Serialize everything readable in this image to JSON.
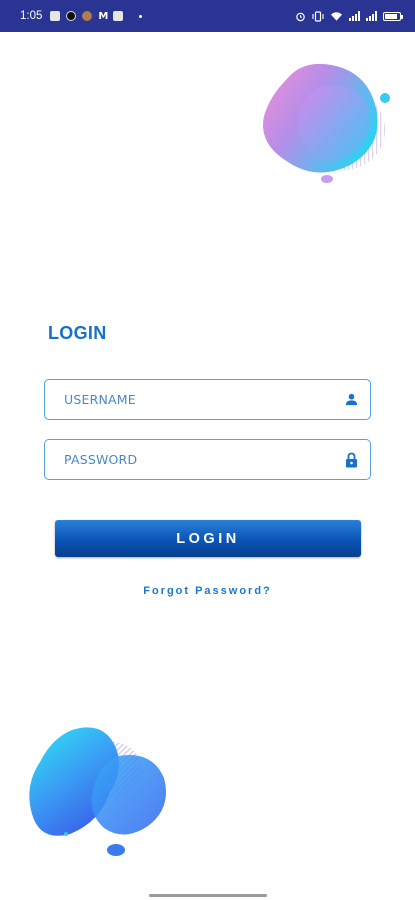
{
  "status_bar": {
    "time": "1:05",
    "notification_icons": [
      "app-icon",
      "app-icon",
      "app-icon",
      "gmail-icon",
      "app-icon",
      "dot-icon"
    ],
    "system_icons": [
      "alarm-icon",
      "vibrate-icon",
      "wifi-icon",
      "signal-icon",
      "signal-icon",
      "battery-icon"
    ],
    "background_color": "#2a3593"
  },
  "login": {
    "title": "LOGIN",
    "username_placeholder": "USERNAME",
    "password_placeholder": "PASSWORD",
    "username_icon": "person-icon",
    "password_icon": "lock-icon",
    "button_label": "LOGIN",
    "forgot_password": "Forgot Password?"
  },
  "colors": {
    "accent": "#1671c8",
    "button": "#0b55b5",
    "field_border": "#5aa0dc"
  }
}
